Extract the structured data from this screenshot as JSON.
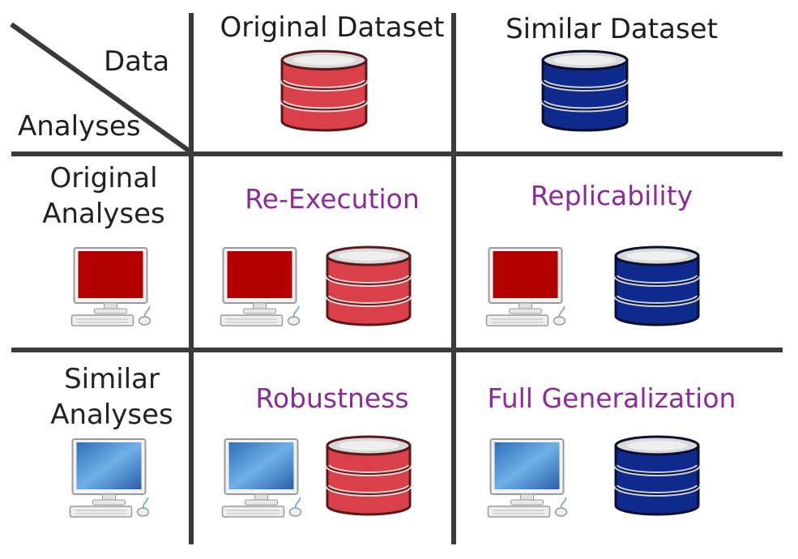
{
  "header": {
    "data_label": "Data",
    "analyses_label": "Analyses",
    "col_original": "Original Dataset",
    "col_similar": "Similar Dataset"
  },
  "rows": {
    "original": [
      "Original",
      "Analyses"
    ],
    "similar": [
      "Similar",
      "Analyses"
    ]
  },
  "cells": {
    "re_execution": "Re-Execution",
    "replicability": "Replicability",
    "robustness": "Robustness",
    "full_generalization": "Full Generalization"
  },
  "colors": {
    "grid": "#3a3a3a",
    "cell_title": "#8b2a9b",
    "original_db": "#d9404a",
    "similar_db": "#0d2a8c",
    "original_screen": "#b30000",
    "similar_screen": "#4a90d0"
  }
}
